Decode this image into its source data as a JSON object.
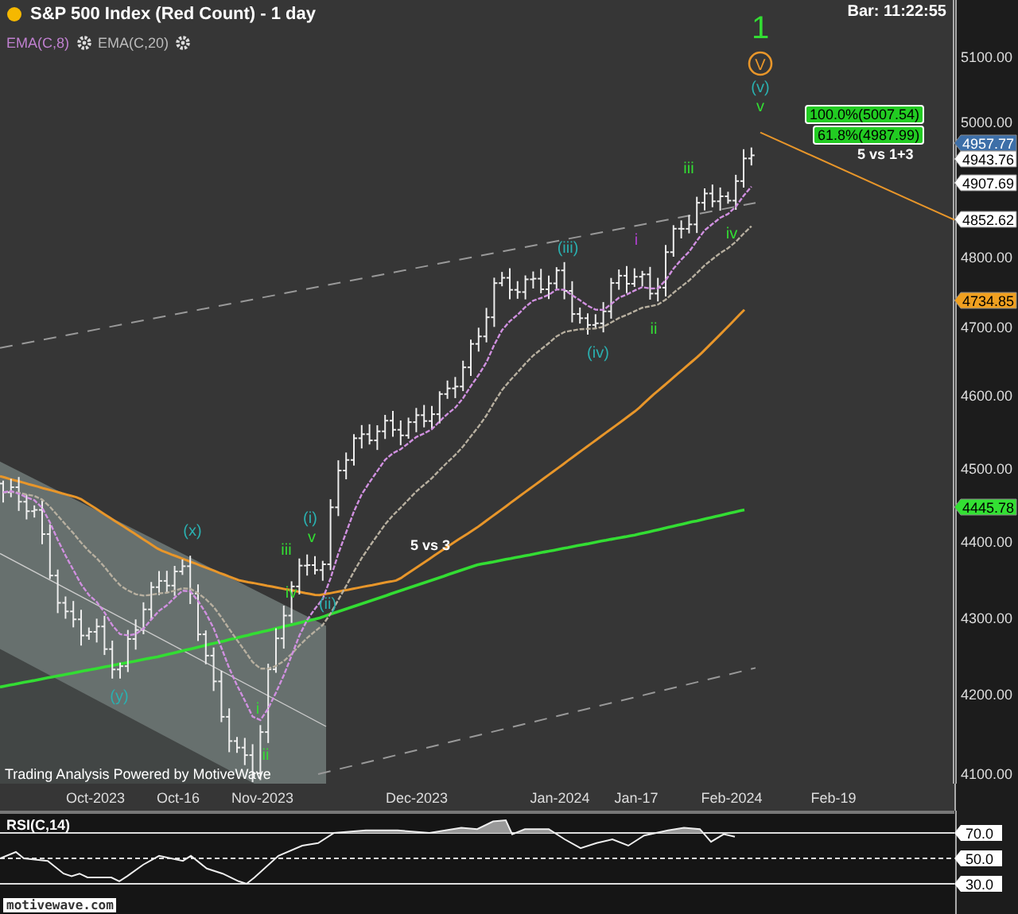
{
  "header": {
    "title": "S&P 500 Index (Red Count) - 1 day",
    "bar_time": "Bar: 11:22:55"
  },
  "indicators": [
    {
      "label": "EMA(C,8)",
      "color": "#c080d0"
    },
    {
      "label": "EMA(C,20)",
      "color": "#bbbbbb"
    }
  ],
  "price_axis": {
    "ticks": [
      "5100.00",
      "5000.00",
      "4800.00",
      "4700.00",
      "4600.00",
      "4500.00",
      "4400.00",
      "4300.00",
      "4200.00",
      "4100.00"
    ]
  },
  "price_tags": [
    {
      "text": "4957.77",
      "color": "#3d6fa8"
    },
    {
      "text": "4943.76",
      "color": "#ffffff"
    },
    {
      "text": "4907.69",
      "color": "#ffffff"
    },
    {
      "text": "4852.62",
      "color": "#ffffff"
    },
    {
      "text": "4734.85",
      "color": "#f0a020"
    },
    {
      "text": "4445.78",
      "color": "#33e033"
    }
  ],
  "wave_labels": [
    {
      "text": "1",
      "kind": "large",
      "color": "#33dd33"
    },
    {
      "text": "V",
      "kind": "circled",
      "color": "#e8962a"
    },
    {
      "text": "(v)",
      "kind": "plain",
      "color": "#2ab0b0"
    },
    {
      "text": "v",
      "kind": "plain",
      "color": "#33dd33"
    },
    {
      "text": "iii",
      "kind": "plain",
      "color": "#33dd33"
    },
    {
      "text": "iv",
      "kind": "plain",
      "color": "#33dd33"
    },
    {
      "text": "i",
      "kind": "plain",
      "color": "#b040d0"
    },
    {
      "text": "ii",
      "kind": "plain",
      "color": "#33dd33"
    },
    {
      "text": "(iii)",
      "kind": "plain",
      "color": "#2ab0b0"
    },
    {
      "text": "(iv)",
      "kind": "plain",
      "color": "#2ab0b0"
    },
    {
      "text": "(i)",
      "kind": "plain",
      "color": "#2ab0b0"
    },
    {
      "text": "v",
      "kind": "plain",
      "color": "#33dd33"
    },
    {
      "text": "iii",
      "kind": "plain",
      "color": "#33dd33"
    },
    {
      "text": "iv",
      "kind": "plain",
      "color": "#33dd33"
    },
    {
      "text": "(ii)",
      "kind": "plain",
      "color": "#2ab0b0"
    },
    {
      "text": "(x)",
      "kind": "plain",
      "color": "#2ab0b0"
    },
    {
      "text": "(y)",
      "kind": "plain",
      "color": "#2ab0b0"
    },
    {
      "text": "i",
      "kind": "plain",
      "color": "#33dd33"
    },
    {
      "text": "ii",
      "kind": "plain",
      "color": "#33dd33"
    }
  ],
  "fib_boxes": [
    "100.0%(5007.54)",
    "61.8%(4987.99)"
  ],
  "annotations": [
    "5 vs 1+3",
    "5 vs 3"
  ],
  "footer": "Trading Analysis Powered by MotiveWave",
  "time_axis": {
    "labels": [
      "Oct-2023",
      "Oct-16",
      "Nov-2023",
      "Dec-2023",
      "Jan-2024",
      "Jan-17",
      "Feb-2024",
      "Feb-19"
    ]
  },
  "rsi": {
    "title": "RSI(C,14)",
    "ticks": [
      "70.0",
      "50.0",
      "30.0"
    ]
  },
  "watermark_link": "motivewave.com"
}
